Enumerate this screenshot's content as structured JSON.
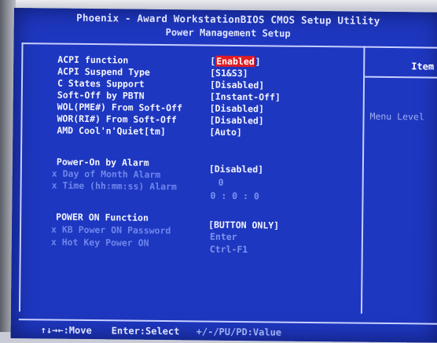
{
  "title": {
    "line1": "Phoenix - Award WorkstationBIOS CMOS Setup Utility",
    "line2": "Power Management Setup"
  },
  "help_panel": {
    "header": "Item",
    "menu_level": "Menu Level"
  },
  "settings": [
    {
      "label": "ACPI function",
      "value_open": "[",
      "value": "Enabled",
      "value_close": "]",
      "highlighted": true,
      "dimmed": false
    },
    {
      "label": "ACPI Suspend Type",
      "value": "[S1&S3]",
      "dimmed": false
    },
    {
      "label": "C States Support",
      "value": "[Disabled]",
      "dimmed": false
    },
    {
      "label": "Soft-Off by PBTN",
      "value": "[Instant-Off]",
      "dimmed": false
    },
    {
      "label": "WOL(PME#) From Soft-Off",
      "value": "[Disabled]",
      "dimmed": false
    },
    {
      "label": "WOR(RI#) From Soft-Off",
      "value": "[Disabled]",
      "dimmed": false
    },
    {
      "label": "AMD Cool'n'Quiet[tm]",
      "value": "[Auto]",
      "dimmed": false
    },
    {
      "label": "Power-On by Alarm",
      "value": "[Disabled]",
      "dimmed": false
    },
    {
      "label": "x Day of Month Alarm",
      "value": "0",
      "dimmed": true
    },
    {
      "label": "x Time (hh:mm:ss) Alarm",
      "value": "0 : 0 : 0",
      "dimmed": true
    },
    {
      "label": "POWER ON Function",
      "value": "[BUTTON ONLY]",
      "dimmed": false
    },
    {
      "label": "x KB Power ON Password",
      "value": "Enter",
      "dimmed": true
    },
    {
      "label": "x Hot Key Power ON",
      "value": "Ctrl-F1",
      "dimmed": true
    }
  ],
  "footer": {
    "move": "↑↓→←:Move",
    "select": "Enter:Select",
    "change": "+/-/PU/PD:Value"
  }
}
